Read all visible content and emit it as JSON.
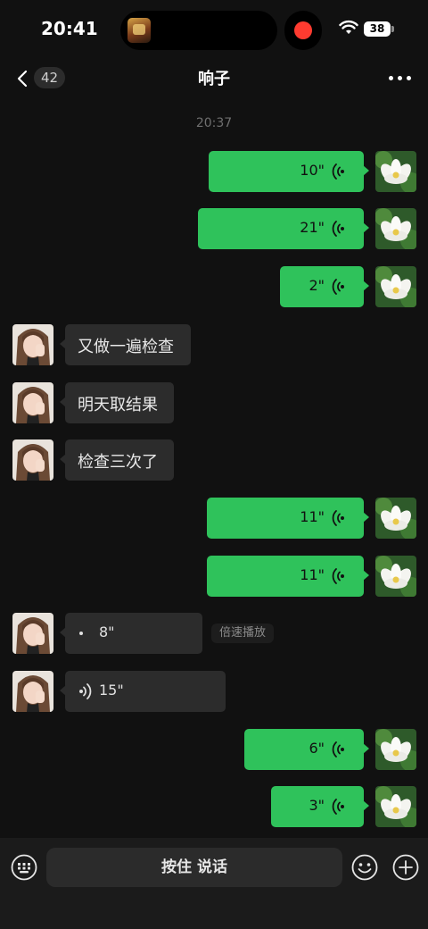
{
  "status_bar": {
    "time": "20:41",
    "battery": "38"
  },
  "header": {
    "unread_count": "42",
    "title": "响子"
  },
  "chat": {
    "timestamp": "20:37",
    "messages": [
      {
        "sender": "me",
        "type": "voice",
        "duration": "10\""
      },
      {
        "sender": "me",
        "type": "voice",
        "duration": "21\""
      },
      {
        "sender": "me",
        "type": "voice",
        "duration": "2\""
      },
      {
        "sender": "other",
        "type": "text",
        "text": "又做一遍检查"
      },
      {
        "sender": "other",
        "type": "text",
        "text": "明天取结果"
      },
      {
        "sender": "other",
        "type": "text",
        "text": "检查三次了"
      },
      {
        "sender": "me",
        "type": "voice",
        "duration": "11\""
      },
      {
        "sender": "me",
        "type": "voice",
        "duration": "11\""
      },
      {
        "sender": "other",
        "type": "voice",
        "duration": "8\"",
        "speed_label": "倍速播放"
      },
      {
        "sender": "other",
        "type": "voice",
        "duration": "15\""
      },
      {
        "sender": "me",
        "type": "voice",
        "duration": "6\""
      },
      {
        "sender": "me",
        "type": "voice",
        "duration": "3\""
      }
    ]
  },
  "input_bar": {
    "hold_to_talk_label": "按住 说话",
    "icons": [
      "keyboard-icon",
      "emoji-icon",
      "plus-icon"
    ]
  },
  "colors": {
    "background": "#111111",
    "outgoing_bubble": "#2fc25b",
    "incoming_bubble": "#2c2c2c",
    "recording_dot": "#ff3b30"
  }
}
